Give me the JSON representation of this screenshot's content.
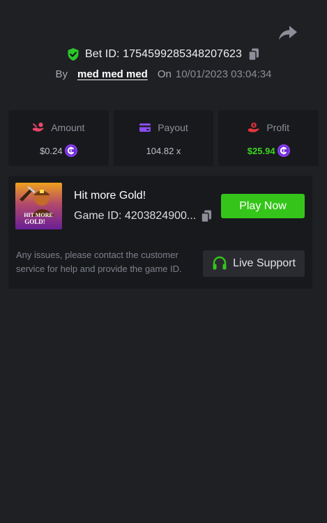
{
  "header": {
    "bet_id_label": "Bet ID: 1754599285348207623",
    "by_label": "By",
    "username": "med med med",
    "on_label": "On",
    "datetime": "10/01/2023 03:04:34"
  },
  "stats": {
    "amount": {
      "label": "Amount",
      "value": "$0.24",
      "icon": "hand-coins-icon"
    },
    "payout": {
      "label": "Payout",
      "value": "104.82 x",
      "icon": "card-icon"
    },
    "profit": {
      "label": "Profit",
      "value": "$25.94",
      "icon": "hand-money-icon"
    }
  },
  "game": {
    "title": "Hit more Gold!",
    "id_label": "Game ID: 4203824900...",
    "thumbnail_text": [
      "HIT MORE",
      "GOLD!"
    ],
    "play_label": "Play Now"
  },
  "support": {
    "note": "Any issues, please contact the customer service for help and provide the game ID.",
    "button_label": "Live Support"
  },
  "colors": {
    "background": "#1f2024",
    "card": "#18191d",
    "accent_green": "#35c51a",
    "profit_green": "#3bd51f",
    "coin_purple": "#8a3df0"
  }
}
